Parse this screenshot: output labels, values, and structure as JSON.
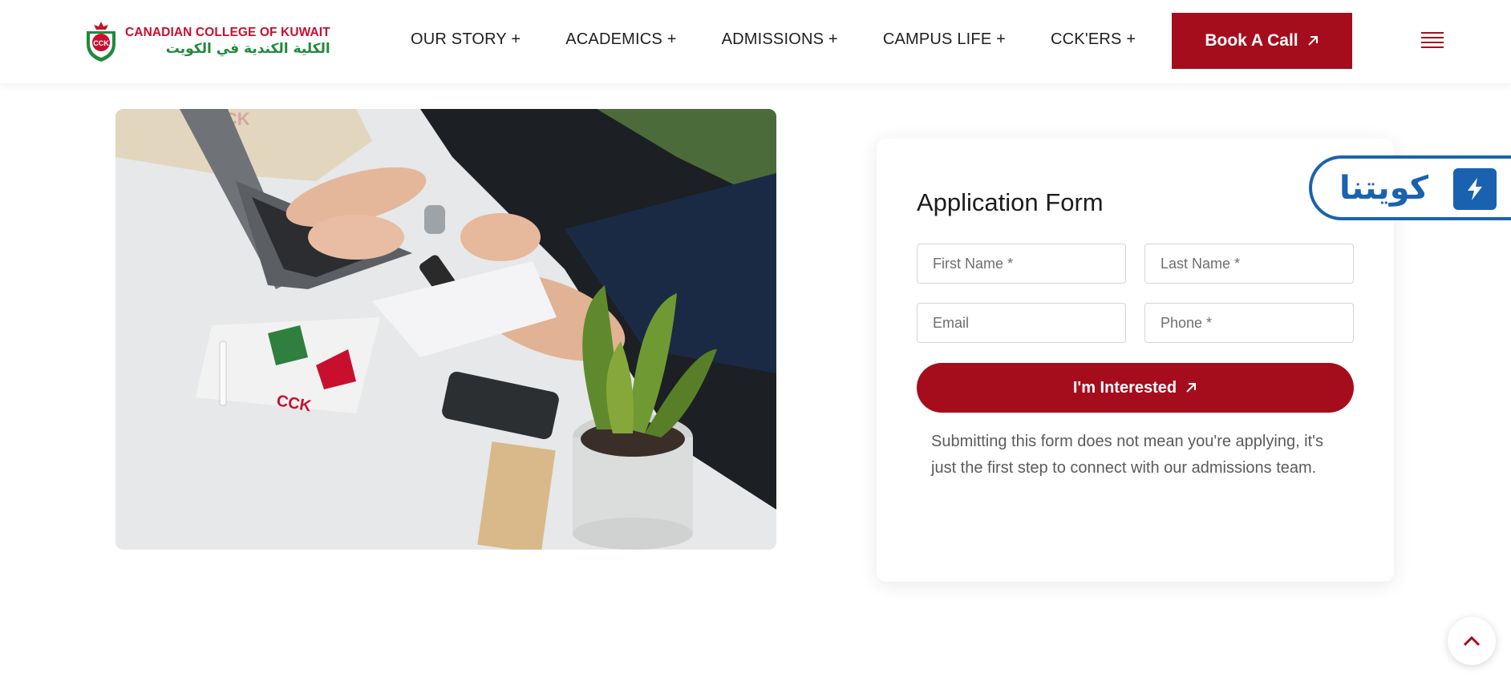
{
  "header": {
    "logo": {
      "name_en": "CANADIAN COLLEGE OF KUWAIT",
      "name_ar": "الكلية الكندية في الكويت",
      "crest_letters": "CCK"
    },
    "nav": [
      {
        "label": "OUR STORY +"
      },
      {
        "label": "ACADEMICS +"
      },
      {
        "label": "ADMISSIONS +"
      },
      {
        "label": "CAMPUS LIFE +"
      },
      {
        "label": "CCK'ERS +"
      }
    ],
    "book_call_label": "Book A Call",
    "menu_icon": "hamburger-icon"
  },
  "photo": {
    "description_icon": "photo-students-laptop"
  },
  "form": {
    "title": "Application Form",
    "first_name_placeholder": "First Name *",
    "last_name_placeholder": "Last Name *",
    "email_placeholder": "Email",
    "phone_placeholder": "Phone *",
    "submit_label": "I'm Interested",
    "note": "Submitting this form does not mean you're applying, it's just the first step to connect with our admissions team."
  },
  "badge": {
    "text": "كويتنا",
    "icon": "lightning-icon"
  },
  "scroll_top_icon": "chevron-up-icon",
  "colors": {
    "brand_red": "#a50d1c",
    "logo_green": "#1f8a3c",
    "badge_blue": "#1a62b0"
  }
}
